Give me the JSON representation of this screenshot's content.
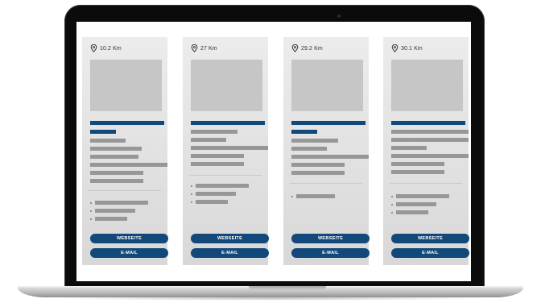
{
  "cards": [
    {
      "distance": "10.2 Km",
      "website_label": "WEBSEITE",
      "email_label": "E-MAIL"
    },
    {
      "distance": "27 Km",
      "website_label": "WEBSEITE",
      "email_label": "E-MAIL"
    },
    {
      "distance": "29.2 Km",
      "website_label": "WEBSEITE",
      "email_label": "E-MAIL"
    },
    {
      "distance": "30.1 Km",
      "website_label": "WEBSEITE",
      "email_label": "E-MAIL"
    }
  ],
  "icons": {
    "distance": "location-pin-icon"
  },
  "colors": {
    "accent": "#12487a",
    "placeholder_text": "#979797",
    "image_placeholder": "#c6c6c6",
    "card_background": "#e4e4e4",
    "bezel": "#0b0b0b"
  }
}
